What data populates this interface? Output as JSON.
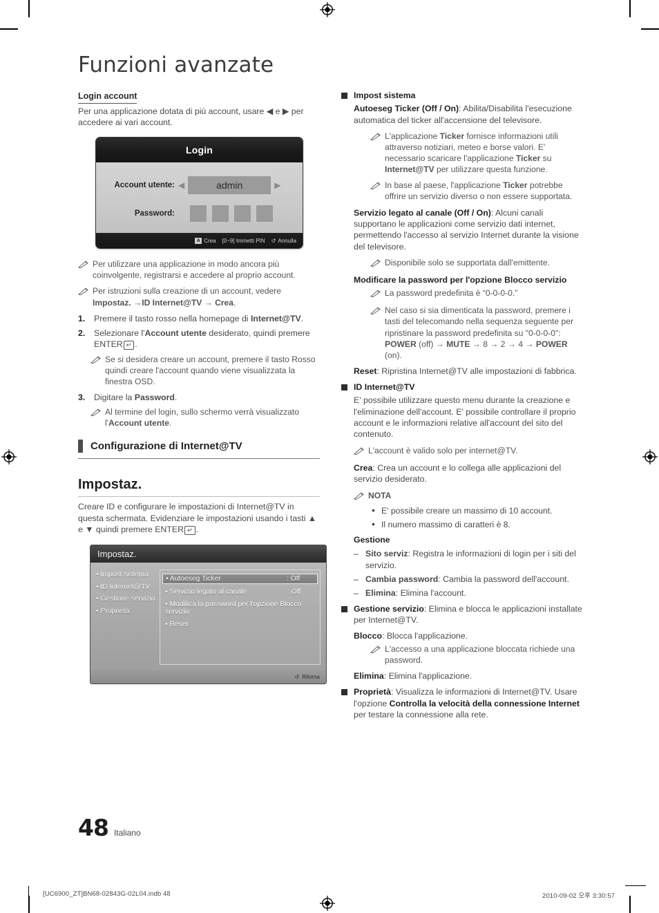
{
  "document": {
    "title": "Funzioni avanzate",
    "page_number": "48",
    "language": "Italiano",
    "footer_left": "[UC6900_ZT]BN68-02843G-02L04.indb   48",
    "footer_right": "2010-09-02   오후 3:30:57"
  },
  "left_column": {
    "login_heading": "Login account",
    "login_intro": "Per una applicazione dotata di più account, usare ◀ e ▶ per accedere ai vari account.",
    "login_osd": {
      "title": "Login",
      "account_label": "Account utente:",
      "account_value": "admin",
      "password_label": "Password:",
      "password_dots": 4,
      "footer": {
        "key_a": "A",
        "create": "Crea",
        "pin": "[0~9] Immetti PIN",
        "return_icon": "↺",
        "cancel": "Annulla"
      }
    },
    "notes": [
      "Per utilizzare una applicazione in modo ancora più coinvolgente, registrarsi e accedere al proprio account."
    ],
    "note_crea": {
      "pre": "Per istruzioni sulla creazione di un account, vedere ",
      "bold1": "Impostaz. →ID Internet@TV → Crea",
      "post": "."
    },
    "steps": [
      {
        "n": "1.",
        "pre": "Premere il tasto rosso nella homepage di ",
        "bold": "Internet@TV",
        "post": "."
      },
      {
        "n": "2.",
        "pre": "Selezionare l'",
        "bold": "Account utente",
        "post": " desiderato, quindi premere ENTER",
        "key": "↵",
        "tail": "."
      },
      {
        "n": "3.",
        "pre": "Digitare la ",
        "bold": "Password",
        "post": "."
      }
    ],
    "step2_note": "Se si desidera creare un account, premere il tasto Rosso quindi creare l'account quando viene visualizzata la finestra OSD.",
    "step3_note": {
      "pre": "Al termine del login, sullo schermo verrà visualizzato l'",
      "bold": "Account utente",
      "post": "."
    },
    "section_heading": "Configurazione di Internet@TV",
    "impostaz_heading": "Impostaz.",
    "impostaz_intro_pre": "Creare ID e configurare le impostazioni di Internet@TV in questa schermata. Evidenziare le impostazioni usando i tasti ▲ e ▼ quindi premere ENTER",
    "impostaz_intro_key": "↵",
    "impostaz_intro_post": ".",
    "impostaz_osd": {
      "title": "Impostaz.",
      "menu": [
        "• Impost sistema",
        "• ID Internet@TV",
        "• Gestione servizio",
        "• Proprietà"
      ],
      "options": [
        {
          "name": "• Autoeseg Ticker",
          "value": ": Off",
          "selected": true
        },
        {
          "name": "• Servizio legato al canale",
          "value": ": Off",
          "selected": false
        },
        {
          "name": "• Modifica la password per l'opzione Blocco servizio",
          "value": "",
          "selected": false,
          "wrap": true
        },
        {
          "name": "• Reset",
          "value": "",
          "selected": false
        }
      ],
      "footer_icon": "↺",
      "footer_label": "Ritorna"
    }
  },
  "right_column": {
    "impost_sistema": {
      "heading": "Impost sistema",
      "ticker_bold": "Autoeseg Ticker (Off / On)",
      "ticker_text": ": Abilita/Disabilita l'esecuzione automatica del ticker all'accensione del televisore.",
      "note1_p1": "L'applicazione ",
      "note1_b1": "Ticker",
      "note1_p2": " fornisce informazioni utili attraverso notiziari, meteo e borse valori. E' necessario scaricare l'applicazione ",
      "note1_b2": "Ticker",
      "note1_p3": " su ",
      "note1_b3": "Internet@TV",
      "note1_p4": " per utilizzare questa funzione.",
      "note2_p1": "In base al paese, l'applicazione ",
      "note2_b1": "Ticker",
      "note2_p2": " potrebbe offrire un servizio diverso o non essere supportata.",
      "servizio_bold": "Servizio legato al canale (Off / On)",
      "servizio_text": ": Alcuni canali supportano le applicazioni come servizio dati internet, permettendo l'accesso al servizio Internet durante la visione del televisore.",
      "servizio_note": "Disponibile solo se supportata dall'emittente.",
      "modifica_heading": "Modificare la password per l'opzione Blocco servizio",
      "modifica_note1": "La password predefinita è “0-0-0-0.”",
      "modifica_note2_a": "Nel caso si sia dimenticata la password, premere i tasti del telecomando nella sequenza seguente per ripristinare la password predefinita su \"0-0-0-0\": ",
      "modifica_note2_b1": "POWER",
      "modifica_note2_c": " (off) → ",
      "modifica_note2_b2": "MUTE",
      "modifica_note2_d": " → 8 → 2 → 4 → ",
      "modifica_note2_b3": "POWER",
      "modifica_note2_e": " (on).",
      "reset_bold": "Reset",
      "reset_text": ": Ripristina Internet@TV alle impostazioni di fabbrica."
    },
    "id_internet": {
      "heading": "ID Internet@TV",
      "text": "E' possibile utilizzare questo menu durante la creazione e l'eliminazione dell'account. E' possibile controllare il proprio account e le informazioni relative all'account del sito del contenuto.",
      "note": "L'account è valido solo per internet@TV.",
      "crea_bold": "Crea",
      "crea_text": ": Crea un account e lo collega alle applicazioni del servizio desiderato.",
      "nota_label": "NOTA",
      "nota_items": [
        "E' possibile creare un massimo di 10 account.",
        "Il numero massimo di caratteri è 8."
      ],
      "gestione_heading": "Gestione",
      "gestione_items": [
        {
          "bold": "Sito serviz",
          "text": ": Registra le informazioni di login per i siti del servizio."
        },
        {
          "bold": "Cambia password",
          "text": ": Cambia la password dell'account."
        },
        {
          "bold": "Elimina",
          "text": ": Elimina l'account."
        }
      ]
    },
    "gestione_servizio": {
      "heading_bold": "Gestione servizio",
      "heading_text": ": Elimina e blocca le applicazioni installate per Internet@TV.",
      "blocco_bold": "Blocco",
      "blocco_text": ": Blocca l'applicazione.",
      "blocco_note": "L'accesso a una applicazione bloccata richiede una password.",
      "elimina_bold": "Elimina",
      "elimina_text": ": Elimina l'applicazione."
    },
    "proprieta": {
      "bold": "Proprietà",
      "p1": ": Visualizza le informazioni di Internet@TV. Usare l'opzione ",
      "b2": "Controlla la velocità della connessione Internet",
      "p2": " per testare la connessione alla rete."
    }
  }
}
